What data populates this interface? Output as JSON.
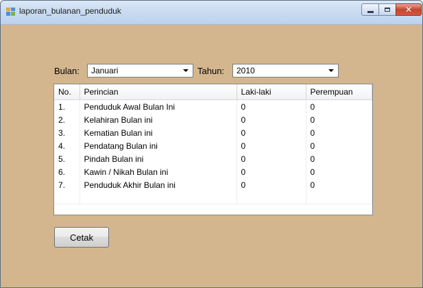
{
  "window": {
    "title": "laporan_bulanan_penduduk"
  },
  "filters": {
    "month_label": "Bulan:",
    "month_value": "Januari",
    "year_label": "Tahun:",
    "year_value": "2010"
  },
  "table": {
    "columns": [
      "No.",
      "Perincian",
      "Laki-laki",
      "Perempuan"
    ],
    "rows": [
      [
        "1.",
        "Penduduk Awal Bulan Ini",
        "0",
        "0"
      ],
      [
        "2.",
        "Kelahiran Bulan ini",
        "0",
        "0"
      ],
      [
        "3.",
        "Kematian Bulan ini",
        "0",
        "0"
      ],
      [
        "4.",
        "Pendatang Bulan ini",
        "0",
        "0"
      ],
      [
        "5.",
        "Pindah Bulan ini",
        "0",
        "0"
      ],
      [
        "6.",
        "Kawin / Nikah Bulan ini",
        "0",
        "0"
      ],
      [
        "7.",
        "Penduduk Akhir Bulan ini",
        "0",
        "0"
      ]
    ]
  },
  "actions": {
    "print_label": "Cetak"
  },
  "colors": {
    "form_background": "#d3b68d",
    "titlebar": "#cadcf1",
    "close_button": "#c7452f"
  },
  "icons": {
    "app": "form-app-icon",
    "minimize": "minimize-icon",
    "maximize": "maximize-icon",
    "close": "close-icon",
    "dropdown": "dropdown-arrow-icon"
  }
}
